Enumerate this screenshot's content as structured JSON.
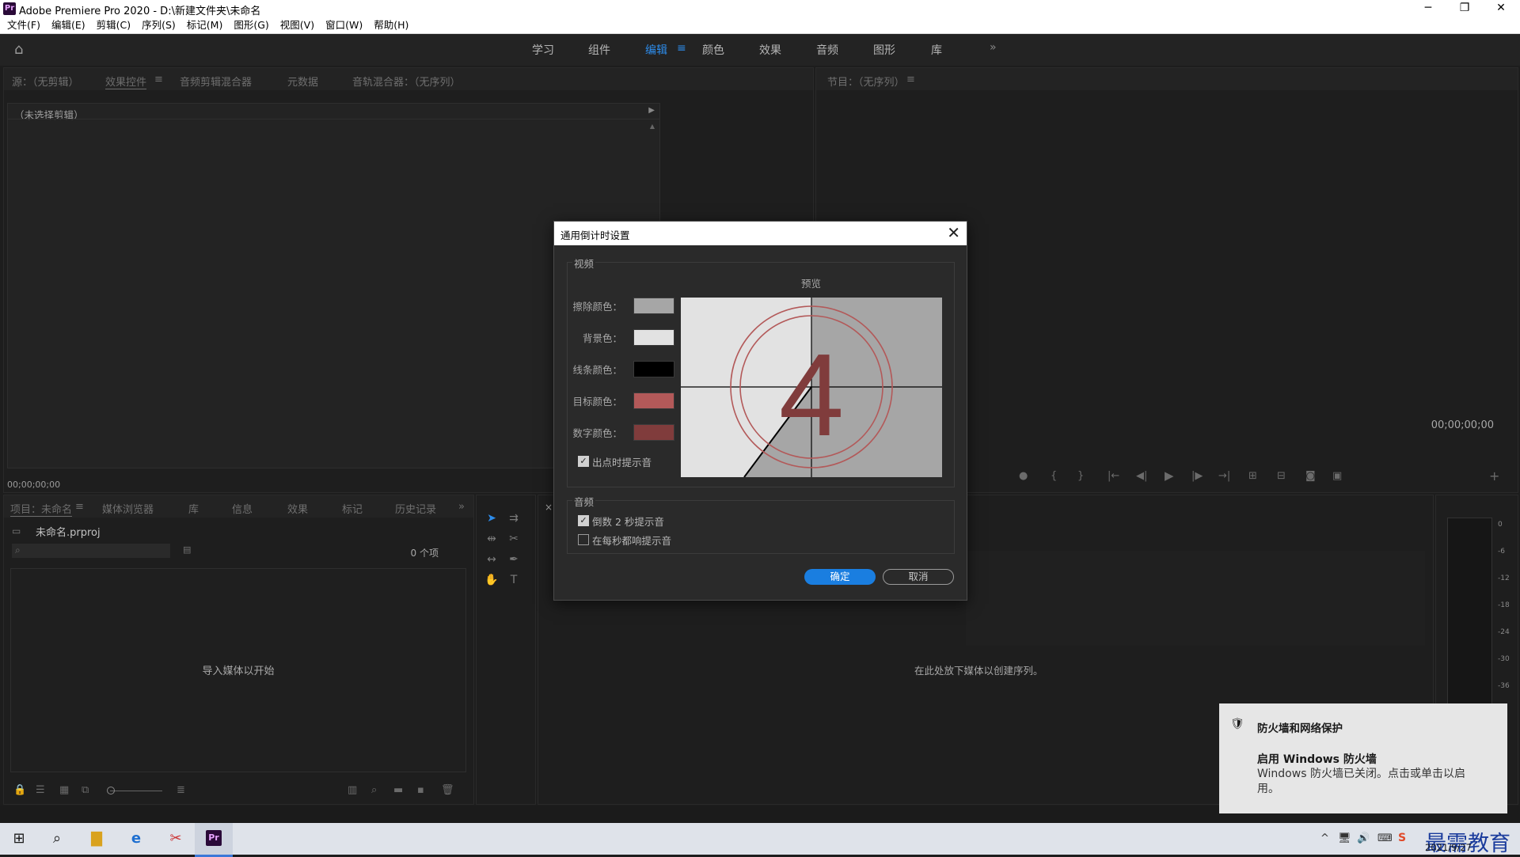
{
  "window": {
    "title": "Adobe Premiere Pro 2020 - D:\\新建文件夹\\未命名",
    "logo_text": "Pr"
  },
  "menu": [
    "文件(F)",
    "编辑(E)",
    "剪辑(C)",
    "序列(S)",
    "标记(M)",
    "图形(G)",
    "视图(V)",
    "窗口(W)",
    "帮助(H)"
  ],
  "workspaces": {
    "tabs": [
      "学习",
      "组件",
      "编辑",
      "颜色",
      "效果",
      "音频",
      "图形",
      "库"
    ],
    "active": "编辑",
    "menu_glyph": "≡",
    "overflow": "»"
  },
  "source_panel": {
    "tabs": [
      "源：（无剪辑）",
      "效果控件",
      "音频剪辑混合器",
      "元数据",
      "音轨混合器：（无序列）"
    ],
    "active_tab_menu": "≡",
    "no_clip_text": "（未选择剪辑）",
    "timecode": "00;00;00;00"
  },
  "program_panel": {
    "tab": "节目：（无序列）",
    "tab_menu": "≡",
    "timecode": "00;00;00;00",
    "add_button": "+"
  },
  "project_panel": {
    "tabs": [
      "项目：未命名",
      "媒体浏览器",
      "库",
      "信息",
      "效果",
      "标记",
      "历史记录"
    ],
    "tab_menu": "≡",
    "overflow": "»",
    "project_file": "未命名.prproj",
    "item_count": "0 个项",
    "empty_text": "导入媒体以开始"
  },
  "timeline_panel": {
    "close": "×",
    "empty_text": "在此处放下媒体以创建序列。"
  },
  "audio_meter": {
    "ticks": [
      "0",
      "-6",
      "-12",
      "-18",
      "-24",
      "-30",
      "-36"
    ]
  },
  "dialog": {
    "title": "通用倒计时设置",
    "close": "✕",
    "video_group": "视频",
    "preview_label": "预览",
    "colors": [
      {
        "label": "擦除颜色：",
        "hex": "#a6a6a6"
      },
      {
        "label": "背景色：",
        "hex": "#e2e2e2"
      },
      {
        "label": "线条颜色：",
        "hex": "#000000"
      },
      {
        "label": "目标颜色：",
        "hex": "#b35959"
      },
      {
        "label": "数字颜色：",
        "hex": "#803c3c"
      }
    ],
    "cue_at_out": {
      "label": "出点时提示音",
      "checked": true
    },
    "preview_number": "4",
    "audio_group": "音频",
    "audio_options": [
      {
        "label": "倒数 2 秒提示音",
        "checked": true
      },
      {
        "label": "在每秒都响提示音",
        "checked": false
      }
    ],
    "ok": "确定",
    "cancel": "取消"
  },
  "toast": {
    "header": "防火墙和网络保护",
    "title": "启用 Windows 防火墙",
    "body": "Windows 防火墙已关闭。点击或单击以启用。"
  },
  "taskbar": {
    "date": "2021/9/27",
    "watermark": "最需教育"
  },
  "colors": {
    "accent": "#2d8ceb",
    "ok_button": "#1a7ee0"
  }
}
